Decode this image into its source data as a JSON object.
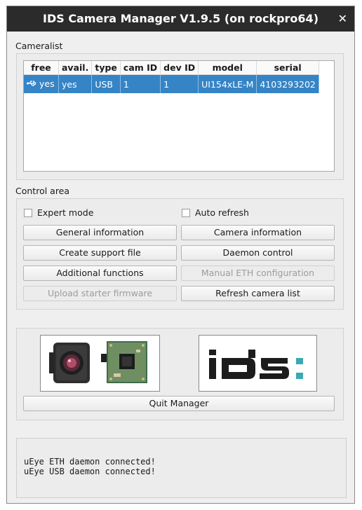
{
  "window": {
    "title": "IDS Camera Manager V1.9.5 (on rockpro64)",
    "close_glyph": "✕"
  },
  "cameralist": {
    "label": "Cameralist",
    "columns": [
      "free",
      "avail.",
      "type",
      "cam ID",
      "dev ID",
      "model",
      "serial"
    ],
    "rows": [
      {
        "icon": "usb-icon",
        "free": "yes",
        "avail": "yes",
        "type": "USB",
        "cam_id": "1",
        "dev_id": "1",
        "model": "UI154xLE-M",
        "serial": "4103293202"
      }
    ]
  },
  "control": {
    "label": "Control area",
    "expert_mode": "Expert mode",
    "auto_refresh": "Auto refresh",
    "general_information": "General information",
    "camera_information": "Camera information",
    "create_support_file": "Create support file",
    "daemon_control": "Daemon control",
    "additional_functions": "Additional functions",
    "manual_eth_configuration": "Manual ETH configuration",
    "upload_starter_firmware": "Upload starter firmware",
    "refresh_camera_list": "Refresh camera list"
  },
  "logo": {
    "text": "IDS"
  },
  "quit_label": "Quit Manager",
  "status_lines": [
    "uEye ETH daemon connected!",
    "uEye USB daemon connected!"
  ],
  "colors": {
    "selection": "#3584c6",
    "titlebar": "#2b2b2b",
    "logo_dark": "#1c1c1c",
    "logo_accent": "#3aa9b1"
  }
}
